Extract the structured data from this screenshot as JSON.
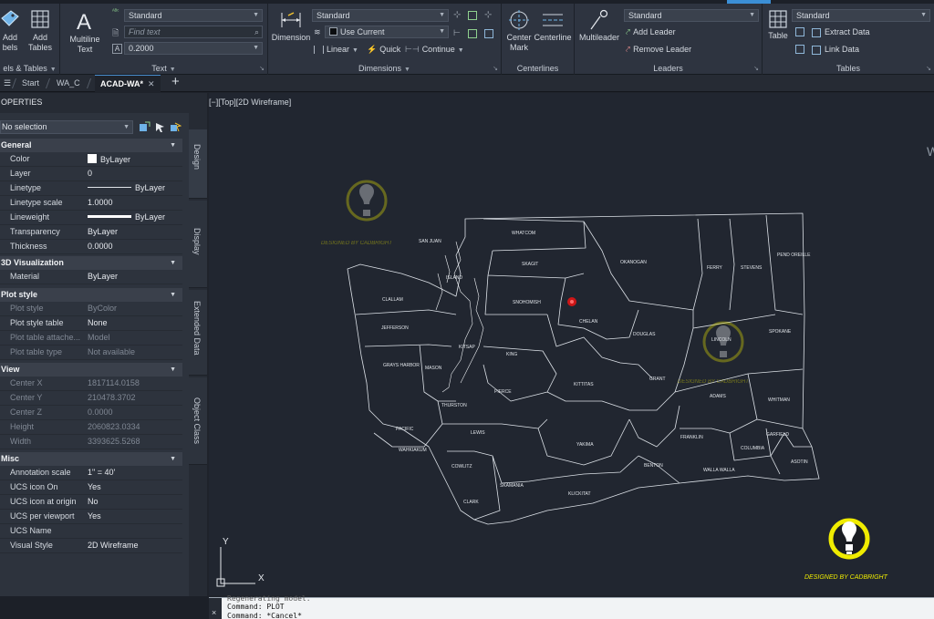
{
  "ribbon": {
    "labels_tables_panel": {
      "add_labels_line1": "Add",
      "add_labels_line2": "bels",
      "add_tables_line1": "Add",
      "add_tables_line2": "Tables",
      "title": "els & Tables"
    },
    "text_panel": {
      "multiline_line1": "Multiline",
      "multiline_line2": "Text",
      "style_value": "Standard",
      "find_placeholder": "Find text",
      "height_value": "0.2000",
      "title": "Text"
    },
    "dimensions_panel": {
      "dimension_label": "Dimension",
      "style_value": "Standard",
      "layer_value": "Use Current",
      "linear_label": "Linear",
      "quick_label": "Quick",
      "continue_label": "Continue",
      "title": "Dimensions"
    },
    "centerlines_panel": {
      "center_mark_line1": "Center",
      "center_mark_line2": "Mark",
      "centerline_label": "Centerline",
      "title": "Centerlines"
    },
    "leaders_panel": {
      "multileader_label": "Multileader",
      "style_value": "Standard",
      "add_leader_label": "Add Leader",
      "remove_leader_label": "Remove Leader",
      "title": "Leaders"
    },
    "tables_panel": {
      "table_label": "Table",
      "style_value": "Standard",
      "extract_data_label": "Extract Data",
      "link_data_label": "Link Data",
      "title": "Tables"
    }
  },
  "tabs": {
    "start": "Start",
    "wa_c": "WA_C",
    "active": "ACAD-WA*"
  },
  "properties": {
    "title": "OPERTIES",
    "selection": "No selection",
    "categories": {
      "general": "General",
      "visualization": "3D Visualization",
      "plot_style": "Plot style",
      "view": "View",
      "misc": "Misc"
    },
    "general": [
      {
        "label": "Color",
        "value": "ByLayer"
      },
      {
        "label": "Layer",
        "value": "0"
      },
      {
        "label": "Linetype",
        "value": "ByLayer"
      },
      {
        "label": "Linetype scale",
        "value": "1.0000"
      },
      {
        "label": "Lineweight",
        "value": "ByLayer"
      },
      {
        "label": "Transparency",
        "value": "ByLayer"
      },
      {
        "label": "Thickness",
        "value": "0.0000"
      }
    ],
    "visualization": [
      {
        "label": "Material",
        "value": "ByLayer"
      }
    ],
    "plot_style": [
      {
        "label": "Plot style",
        "value": "ByColor"
      },
      {
        "label": "Plot style table",
        "value": "None"
      },
      {
        "label": "Plot table attache...",
        "value": "Model"
      },
      {
        "label": "Plot table type",
        "value": "Not available"
      }
    ],
    "view": [
      {
        "label": "Center X",
        "value": "1817114.0158"
      },
      {
        "label": "Center Y",
        "value": "210478.3702"
      },
      {
        "label": "Center Z",
        "value": "0.0000"
      },
      {
        "label": "Height",
        "value": "2060823.0334"
      },
      {
        "label": "Width",
        "value": "3393625.5268"
      }
    ],
    "misc": [
      {
        "label": "Annotation scale",
        "value": "1\" = 40'"
      },
      {
        "label": "UCS icon On",
        "value": "Yes"
      },
      {
        "label": "UCS icon at origin",
        "value": "No"
      },
      {
        "label": "UCS per viewport",
        "value": "Yes"
      },
      {
        "label": "UCS Name",
        "value": ""
      },
      {
        "label": "Visual Style",
        "value": "2D Wireframe"
      }
    ],
    "side_tabs": {
      "design": "Design",
      "display": "Display",
      "extended_data": "Extended Data",
      "object_class": "Object Class"
    }
  },
  "viewport": {
    "label": "[−][Top][2D Wireframe]",
    "ucs_y": "Y",
    "ucs_x": "X",
    "edge_glyph": "W"
  },
  "watermark": {
    "text": "DESIGNED BY CADBRIGHT"
  },
  "counties": [
    {
      "name": "WHATCOM"
    },
    {
      "name": "SAN JUAN"
    },
    {
      "name": "SKAGIT"
    },
    {
      "name": "ISLAND"
    },
    {
      "name": "OKANOGAN"
    },
    {
      "name": "FERRY"
    },
    {
      "name": "STEVENS"
    },
    {
      "name": "PEND OREILLE"
    },
    {
      "name": "CLALLAM"
    },
    {
      "name": "SNOHOMISH"
    },
    {
      "name": "CHELAN"
    },
    {
      "name": "JEFFERSON"
    },
    {
      "name": "KITSAP"
    },
    {
      "name": "KING"
    },
    {
      "name": "DOUGLAS"
    },
    {
      "name": "LINCOLN"
    },
    {
      "name": "SPOKANE"
    },
    {
      "name": "GRAYS HARBOR"
    },
    {
      "name": "MASON"
    },
    {
      "name": "GRANT"
    },
    {
      "name": "KITTITAS"
    },
    {
      "name": "PIERCE"
    },
    {
      "name": "THURSTON"
    },
    {
      "name": "ADAMS"
    },
    {
      "name": "WHITMAN"
    },
    {
      "name": "PACIFIC"
    },
    {
      "name": "LEWIS"
    },
    {
      "name": "FRANKLIN"
    },
    {
      "name": "GARFIELD"
    },
    {
      "name": "COLUMBIA"
    },
    {
      "name": "WAHKIAKUM"
    },
    {
      "name": "YAKIMA"
    },
    {
      "name": "WALLA WALLA"
    },
    {
      "name": "BENTON"
    },
    {
      "name": "ASOTIN"
    },
    {
      "name": "COWLITZ"
    },
    {
      "name": "SKAMANIA"
    },
    {
      "name": "CLARK"
    },
    {
      "name": "KLICKITAT"
    }
  ],
  "command_line": {
    "history1": "Regenerating model.",
    "history2": "Command: PLOT",
    "history3": "Command: *Cancel*",
    "close_glyph": "×"
  },
  "colors": {
    "accent": "#3b8fd6",
    "canvas": "#212630",
    "watermark": "#e8e300",
    "marker": "#e01515"
  }
}
